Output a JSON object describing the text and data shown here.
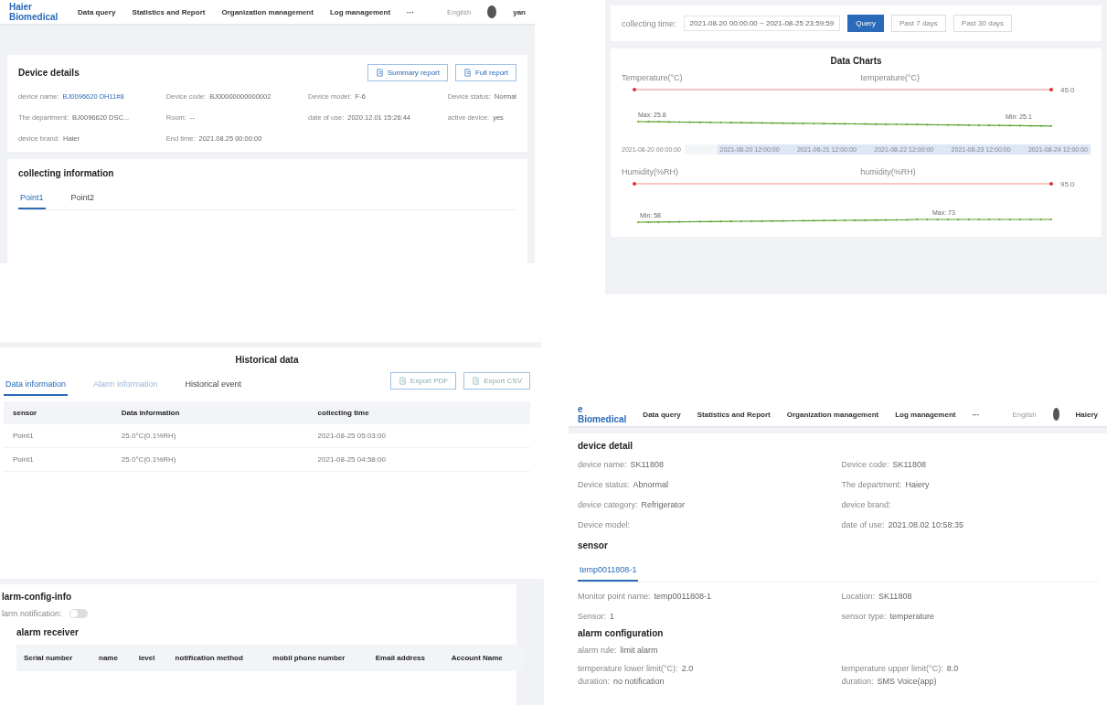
{
  "device_details_panel": {
    "nav": {
      "logo": "Haier Biomedical",
      "items": [
        "Data query",
        "Statistics and Report",
        "Organization management",
        "Log management",
        "···"
      ],
      "language": "English",
      "user": "yan"
    },
    "card": {
      "title": "Device details",
      "buttons": [
        "Summary report",
        "Full report"
      ],
      "fields": [
        {
          "label": "device name:",
          "value": "BJ0096620 DH11#8",
          "kind": "link"
        },
        {
          "label": "Device code:",
          "value": "BJ00000000000002",
          "kind": "text"
        },
        {
          "label": "Device model:",
          "value": "F-6",
          "kind": "text"
        },
        {
          "label": "Device status:",
          "value": "Normal",
          "kind": "text"
        },
        {
          "label": "The department:",
          "value": "BJ0096620 DSC...",
          "kind": "text"
        },
        {
          "label": "Room:",
          "value": "--",
          "kind": "text"
        },
        {
          "label": "date of use:",
          "value": "2020.12.01 15:26:44",
          "kind": "text"
        },
        {
          "label": "active device:",
          "value": "yes",
          "kind": "text"
        },
        {
          "label": "device brand:",
          "value": "Haier",
          "kind": "text"
        },
        {
          "label": "End time:",
          "value": "2021.08.25 00:00:00",
          "kind": "text"
        }
      ]
    },
    "collecting": {
      "title": "collecting information",
      "tabs": [
        {
          "label": "Point1",
          "selected": true
        },
        {
          "label": "Point2",
          "selected": false
        }
      ]
    }
  },
  "charts_panel": {
    "filter": {
      "label": "collecting time:",
      "range": "2021-08-20 00:00:00 ~ 2021-08-25 23:59:59",
      "buttons": [
        {
          "label": "Query",
          "selected": true
        },
        {
          "label": "Past 7 days",
          "selected": false
        },
        {
          "label": "Past 30 days",
          "selected": false
        }
      ]
    },
    "title": "Data Charts",
    "charts": [
      {
        "axis_title": "Temperature(°C)",
        "legend": "temperature(°C)",
        "limit_label": "45.0",
        "max_label": "Max: 25.8",
        "min_label": "Min: 25.1",
        "start_label": "2021-08-20 00:00:00",
        "zoom": {
          "level": 0.92
        },
        "zoom_labels": [
          "2021-08-20 12:00:00",
          "2021-08-21 12:00:00",
          "2021-08-22 12:00:00",
          "2021-08-23 12:00:00",
          "2021-08-24 12:00:00"
        ]
      },
      {
        "axis_title": "Humidity(%RH)",
        "legend": "humidity(%RH)",
        "limit_label": "95.0",
        "max_label": "Max: 73",
        "min_label": "Min: 58"
      }
    ]
  },
  "historical_panel": {
    "title": "Historical data",
    "tabs": [
      {
        "label": "Data information",
        "selected": true
      },
      {
        "label": "Alarm information",
        "selected": false
      },
      {
        "label": "Historical event",
        "selected": false
      }
    ],
    "buttons": [
      "Export PDF",
      "Export CSV"
    ],
    "table": {
      "columns": [
        "sensor",
        "Data information",
        "collecting time"
      ],
      "rows": [
        [
          "Point1",
          "25.0°C(0.1%RH)",
          "2021-08-25 05:03:00"
        ],
        [
          "Point1",
          "25.0°C(0.1%RH)",
          "2021-08-25 04:58:00"
        ]
      ]
    }
  },
  "alarm_panel": {
    "title": "larm-config-info",
    "notification": {
      "label": "larm notification:",
      "on": false
    },
    "receiver_title": "alarm receiver",
    "table": {
      "columns": [
        "Serial number",
        "name",
        "level",
        "notification method",
        "mobil phone number",
        "Email address",
        "Account Name"
      ]
    }
  },
  "device_detail_panel": {
    "nav": {
      "logo": "e Biomedical",
      "items": [
        "Data query",
        "Statistics and Report",
        "Organization management",
        "Log management",
        "···"
      ],
      "language": "English",
      "user": "Haiery"
    },
    "title": "device detail",
    "fields": [
      {
        "label": "device name:",
        "value": "SK11808"
      },
      {
        "label": "Device code:",
        "value": "SK11808"
      },
      {
        "label": "Device status:",
        "value": "Abnormal"
      },
      {
        "label": "The department:",
        "value": "Haiery"
      },
      {
        "label": "device category:",
        "value": "Refrigerator"
      },
      {
        "label": "device brand:"
      },
      {
        "label": "Device model:"
      },
      {
        "label": "date of use:",
        "value": "2021.08.02 10:58:35"
      }
    ],
    "sensor_title": "sensor",
    "sensor_tabs": [
      {
        "label": "temp0011808-1",
        "selected": true
      }
    ],
    "sensor_fields": [
      {
        "label": "Monitor point name:",
        "value": "temp0011808-1"
      },
      {
        "label": "Location:",
        "value": "SK11808"
      },
      {
        "label": "Sensor:",
        "value": "1"
      },
      {
        "label": "sensor type:",
        "value": "temperature"
      }
    ],
    "alarm_title": "alarm configuration",
    "alarm_rule": {
      "label": "alarm rule:",
      "value": "limit alarm"
    },
    "alarm_fields": [
      {
        "label": "temperature lower limit(°C):",
        "value": "2.0"
      },
      {
        "label": "temperature upper limit(°C):",
        "value": "8.0"
      },
      {
        "label": "duration:",
        "value": "no notification"
      },
      {
        "label": "duration:",
        "value": "SMS Voice(app)"
      }
    ]
  }
}
